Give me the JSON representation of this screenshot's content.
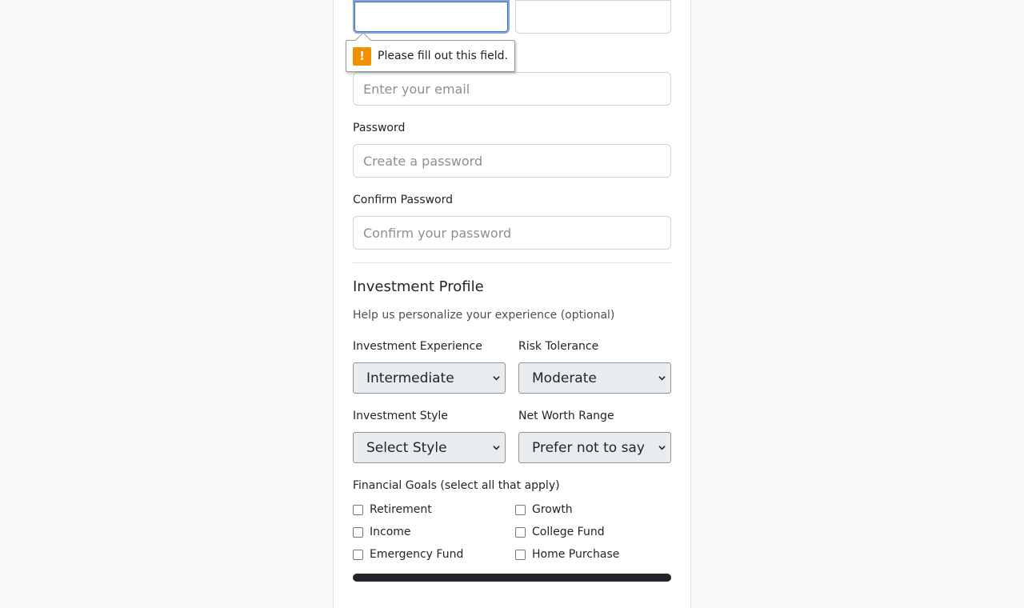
{
  "account": {
    "first_name_value": "",
    "last_name_value": "",
    "email_placeholder": "Enter your email",
    "password_label": "Password",
    "password_placeholder": "Create a password",
    "confirm_label": "Confirm Password",
    "confirm_placeholder": "Confirm your password"
  },
  "validation_tooltip": {
    "message": "Please fill out this field.",
    "icon": "warning-icon"
  },
  "investment_profile": {
    "title": "Investment Profile",
    "help": "Help us personalize your experience (optional)",
    "experience_label": "Investment Experience",
    "experience_value": "Intermediate",
    "risk_label": "Risk Tolerance",
    "risk_value": "Moderate",
    "style_label": "Investment Style",
    "style_value": "Select Style",
    "networth_label": "Net Worth Range",
    "networth_value": "Prefer not to say",
    "goals_label": "Financial Goals (select all that apply)",
    "goals": [
      {
        "label": "Retirement",
        "checked": false
      },
      {
        "label": "Growth",
        "checked": false
      },
      {
        "label": "Income",
        "checked": false
      },
      {
        "label": "College Fund",
        "checked": false
      },
      {
        "label": "Emergency Fund",
        "checked": false
      },
      {
        "label": "Home Purchase",
        "checked": false
      }
    ]
  },
  "colors": {
    "page_bg": "#f8f9fa",
    "focus_border": "#3b6fc4",
    "warning": "#f29100",
    "select_bg": "#e9ecef"
  }
}
